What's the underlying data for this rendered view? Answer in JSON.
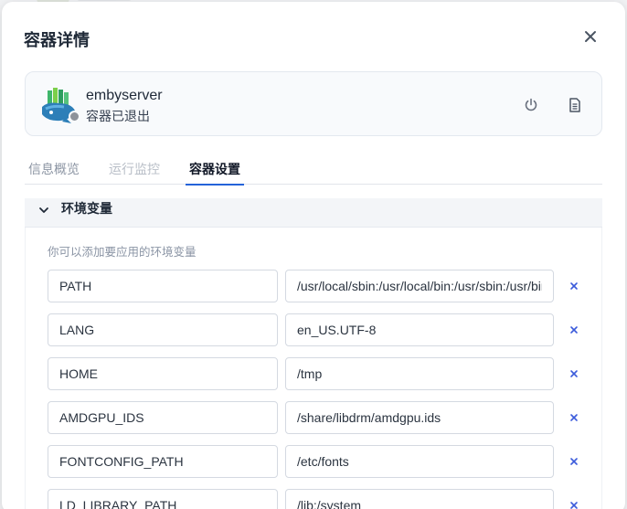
{
  "dialog": {
    "title": "容器详情",
    "close_icon": "close-icon"
  },
  "container": {
    "name": "embyserver",
    "status": "容器已退出",
    "status_color": "#8d929a",
    "actions": [
      "power-icon",
      "document-icon"
    ]
  },
  "tabs": [
    {
      "label": "信息概览",
      "active": false
    },
    {
      "label": "运行监控",
      "active": false,
      "disabled": true
    },
    {
      "label": "容器设置",
      "active": true
    }
  ],
  "env_section": {
    "title": "环境变量",
    "expanded": true,
    "hint": "你可以添加要应用的环境变量",
    "variables": [
      {
        "key": "PATH",
        "value": "/usr/local/sbin:/usr/local/bin:/usr/sbin:/usr/bin:/sbin:/bin"
      },
      {
        "key": "LANG",
        "value": "en_US.UTF-8"
      },
      {
        "key": "HOME",
        "value": "/tmp"
      },
      {
        "key": "AMDGPU_IDS",
        "value": "/share/libdrm/amdgpu.ids"
      },
      {
        "key": "FONTCONFIG_PATH",
        "value": "/etc/fonts"
      },
      {
        "key": "LD_LIBRARY_PATH",
        "value": "/lib:/system"
      }
    ]
  },
  "colors": {
    "accent": "#2563d9",
    "remove_icon": "#3b5bdb"
  }
}
